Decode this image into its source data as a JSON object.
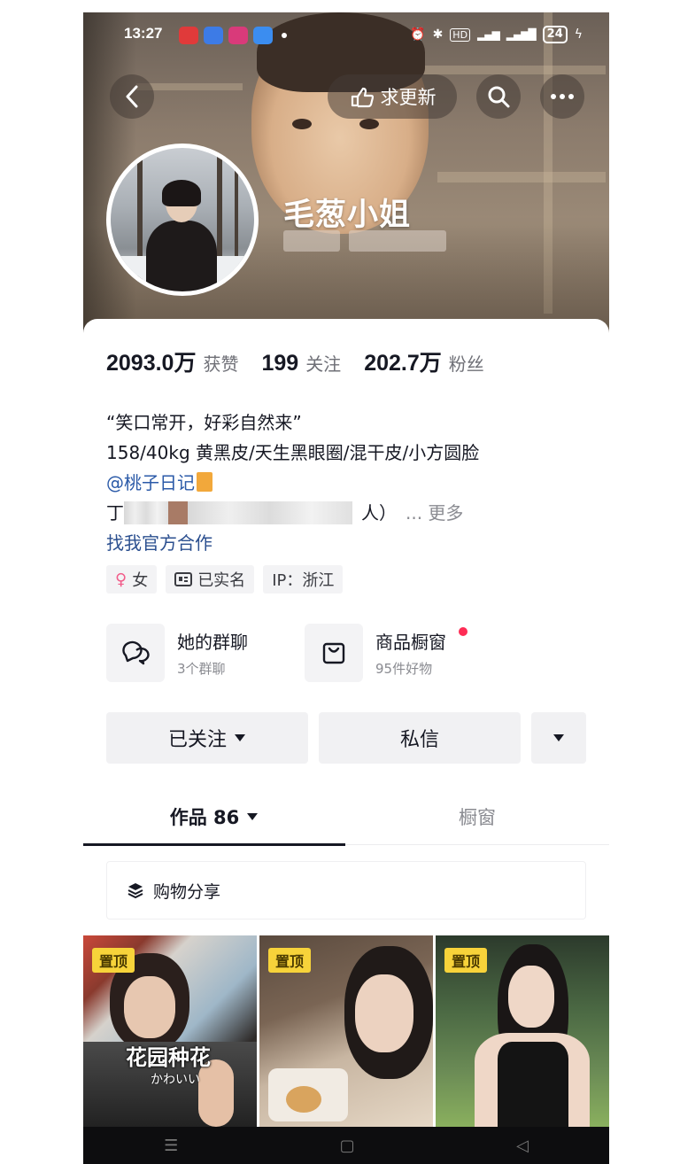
{
  "status_bar": {
    "time": "13:27",
    "signal_text": "HD",
    "battery": "24",
    "app_icon_colors": [
      "#e03a3a",
      "#3d7be6",
      "#d93a7a",
      "#3b8df0"
    ]
  },
  "top_actions": {
    "request_update_label": "求更新"
  },
  "profile": {
    "name": "毛葱小姐"
  },
  "stats": [
    {
      "value": "2093.0万",
      "label": "获赞"
    },
    {
      "value": "199",
      "label": "关注"
    },
    {
      "value": "202.7万",
      "label": "粉丝"
    }
  ],
  "bio": {
    "line1": "“笑口常开，好彩自然来”",
    "line2": "158/40kg 黄黑皮/天生黑眼圈/混干皮/小方圆脸",
    "mention": "@桃子日记",
    "line4_start": "丁",
    "line4_end": "人）",
    "more_label": "... 更多",
    "cooperation_link": "找我官方合作"
  },
  "tags": [
    {
      "icon": "female-icon",
      "label": "女"
    },
    {
      "icon": "id-card-icon",
      "label": "已实名"
    },
    {
      "icon": "",
      "label": "IP：浙江"
    }
  ],
  "features": {
    "group_chat": {
      "title": "她的群聊",
      "subtitle": "3个群聊"
    },
    "shop": {
      "title": "商品橱窗",
      "subtitle": "95件好物"
    }
  },
  "actions": {
    "following_label": "已关注",
    "message_label": "私信"
  },
  "tabs": {
    "works_label": "作品 86",
    "showcase_label": "橱窗"
  },
  "shopping_share_label": "购物分享",
  "videos": [
    {
      "pin_label": "置顶",
      "overlay_text": "花园种花",
      "overlay_sub": "かわいい"
    },
    {
      "pin_label": "置顶"
    },
    {
      "pin_label": "置顶"
    }
  ],
  "colors": {
    "accent_red": "#fe2c55",
    "pin_yellow": "#f7d33a",
    "link_blue": "#2b5aa8"
  }
}
